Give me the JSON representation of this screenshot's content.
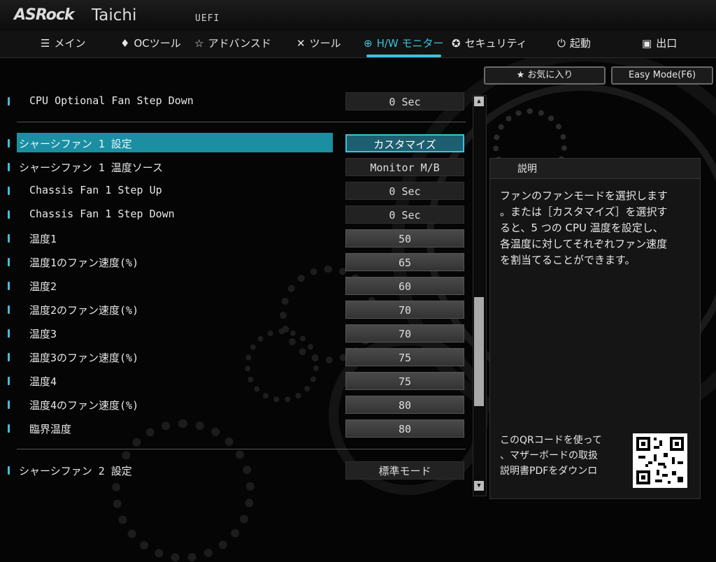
{
  "header": {
    "brand": "ASRock",
    "model": "Taichi",
    "firmware": "UEFI"
  },
  "nav": {
    "items": [
      {
        "label": "メイン",
        "icon": "list-icon"
      },
      {
        "label": "OCツール",
        "icon": "rocket-icon"
      },
      {
        "label": "アドバンスド",
        "icon": "star-icon"
      },
      {
        "label": "ツール",
        "icon": "tools-icon"
      },
      {
        "label": "H/W モニター",
        "icon": "monitor-icon",
        "active": true
      },
      {
        "label": "セキュリティ",
        "icon": "shield-icon"
      },
      {
        "label": "起動",
        "icon": "power-icon"
      },
      {
        "label": "出口",
        "icon": "exit-icon"
      }
    ]
  },
  "quick_buttons": {
    "favorites": "お気に入り",
    "easy_mode": "Easy Mode(F6)"
  },
  "settings": [
    {
      "label": "CPU Optional Fan Step Down",
      "value": "0 Sec",
      "indent": true
    },
    {
      "label": "シャーシファン 1 設定",
      "value": "カスタマイズ",
      "indent": false,
      "selected": true
    },
    {
      "label": "シャーシファン 1 温度ソース",
      "value": "Monitor M/B",
      "indent": false
    },
    {
      "label": "Chassis Fan 1 Step Up",
      "value": "0 Sec",
      "indent": true
    },
    {
      "label": "Chassis Fan 1 Step Down",
      "value": "0 Sec",
      "indent": true
    },
    {
      "label": "温度1",
      "value": "50",
      "indent": true,
      "numeric": true
    },
    {
      "label": "温度1のファン速度(%)",
      "value": "65",
      "indent": true,
      "numeric": true
    },
    {
      "label": "温度2",
      "value": "60",
      "indent": true,
      "numeric": true
    },
    {
      "label": "温度2のファン速度(%)",
      "value": "70",
      "indent": true,
      "numeric": true
    },
    {
      "label": "温度3",
      "value": "70",
      "indent": true,
      "numeric": true
    },
    {
      "label": "温度3のファン速度(%)",
      "value": "75",
      "indent": true,
      "numeric": true
    },
    {
      "label": "温度4",
      "value": "75",
      "indent": true,
      "numeric": true
    },
    {
      "label": "温度4のファン速度(%)",
      "value": "80",
      "indent": true,
      "numeric": true
    },
    {
      "label": "臨界温度",
      "value": "80",
      "indent": true,
      "numeric": true
    },
    {
      "label": "シャーシファン 2 設定",
      "value": "標準モード",
      "indent": false
    }
  ],
  "description": {
    "title": "説明",
    "lines": [
      "ファンのファンモードを選択します",
      "。または［カスタマイズ］を選択す",
      "ると、5 つの CPU 温度を設定し、",
      "各温度に対してそれぞれファン速度",
      "を割当てることができます。"
    ],
    "qr_lines": [
      "このQRコードを使って",
      "、マザーボードの取扱",
      "説明書PDFをダウンロ"
    ]
  },
  "colors": {
    "accent": "#3fc1d9",
    "background": "#050505"
  }
}
